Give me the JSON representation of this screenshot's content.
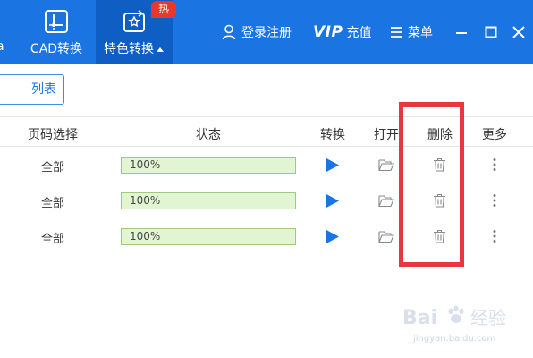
{
  "topbar": {
    "edge_tab_label": "a",
    "tabs": [
      {
        "label": "CAD转换",
        "icon": "cad-icon"
      },
      {
        "label": "特色转换",
        "icon": "special-convert-icon"
      }
    ],
    "hot_badge": "热",
    "login": {
      "label": "登录注册",
      "icon": "user-icon"
    },
    "vip": {
      "mark": "VIP",
      "label": "充值"
    },
    "menu": {
      "label": "菜单",
      "icon": "menu-icon"
    },
    "window_controls": [
      "minimize-icon",
      "maximize-icon",
      "close-icon"
    ],
    "colors": {
      "bar": "#1a74e2",
      "active_tab": "#0f5ec4",
      "badge": "#e8372c"
    }
  },
  "list_button": {
    "label": "列表"
  },
  "table": {
    "headers": {
      "page_select": "页码选择",
      "status": "状态",
      "convert": "转换",
      "open": "打开",
      "delete": "删除",
      "more": "更多"
    },
    "rows": [
      {
        "pages": "全部",
        "status": "100%",
        "progress": 1.0
      },
      {
        "pages": "全部",
        "status": "100%",
        "progress": 1.0
      },
      {
        "pages": "全部",
        "status": "100%",
        "progress": 1.0
      }
    ]
  },
  "annotation": {
    "color": "#e8383d"
  },
  "watermark": {
    "brand": "Bai",
    "brand_suffix": "经验",
    "url": "jingyan.baidu.com"
  }
}
